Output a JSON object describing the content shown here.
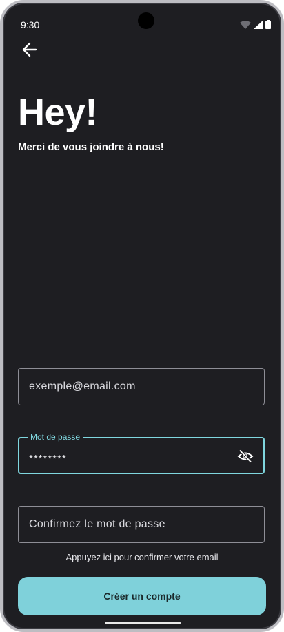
{
  "status": {
    "time": "9:30",
    "icons": [
      "wifi-icon",
      "signal-icon",
      "battery-icon"
    ]
  },
  "header": {
    "back_icon": "arrow-left-icon"
  },
  "content": {
    "title": "Hey!",
    "subtitle": "Merci de vous joindre à nous!"
  },
  "form": {
    "email": {
      "placeholder": "exemple@email.com",
      "value": ""
    },
    "password": {
      "label": "Mot de passe",
      "value": "********",
      "toggle_icon": "eye-off-icon"
    },
    "confirm_password": {
      "placeholder": "Confirmez le mot de passe",
      "value": ""
    },
    "hint": "Appuyez ici pour confirmer votre email",
    "submit_label": "Créer un compte"
  },
  "colors": {
    "background": "#1e1e22",
    "accent": "#7fd6de",
    "button": "#7fd1da"
  }
}
